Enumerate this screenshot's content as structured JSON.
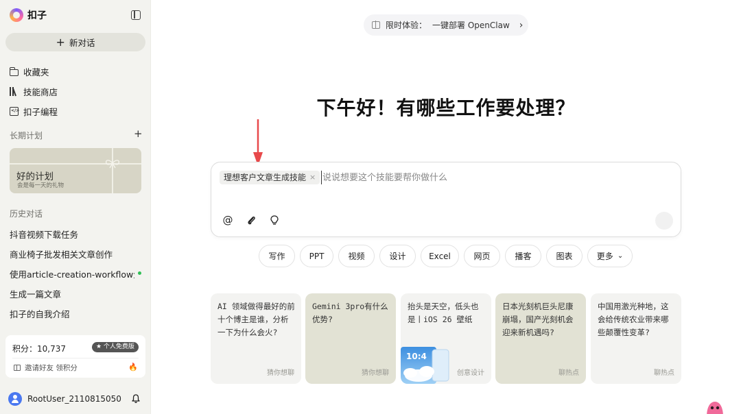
{
  "app": {
    "name": "扣子"
  },
  "sidebar": {
    "new_chat": "新对话",
    "nav": [
      {
        "label": "收藏夹",
        "icon": "folder-icon"
      },
      {
        "label": "技能商店",
        "icon": "books-icon"
      },
      {
        "label": "扣子编程",
        "icon": "code-icon"
      }
    ],
    "long_term_plan_label": "长期计划",
    "plan_card": {
      "title": "好的计划",
      "subtitle": "会是每一天的礼物"
    },
    "history_label": "历史对话",
    "history": [
      "抖音视频下载任务",
      "商业椅子批发相关文章创作",
      "使用article-creation-workflow生…",
      "生成一篇文章",
      "扣子的自我介绍"
    ],
    "points": {
      "label": "积分：10,737",
      "badge": "★ 个人免费版",
      "invite": "邀请好友 领积分"
    },
    "user": {
      "name": "RootUser_2110815050"
    }
  },
  "main": {
    "promo": {
      "prefix": "限时体验：",
      "text": "一键部署 OpenClaw"
    },
    "greeting": "下午好！有哪些工作要处理？",
    "input": {
      "skill_tag": "理想客户文章生成技能",
      "placeholder": "说说想要这个技能要帮你做什么"
    },
    "chips": [
      "写作",
      "PPT",
      "视频",
      "设计",
      "Excel",
      "网页",
      "播客",
      "图表",
      "更多"
    ],
    "cards": [
      {
        "text": "AI 领域做得最好的前十个博主是谁，分析一下为什么会火?",
        "tag": "猜你想聊"
      },
      {
        "text": "Gemini 3pro有什么优势?",
        "tag": "猜你想聊"
      },
      {
        "text": "抬头是天空，低头也是丨iOS 26 壁纸",
        "tag": "创意设计"
      },
      {
        "text": "日本光刻机巨头尼康崩塌，国产光刻机会迎来新机遇吗?",
        "tag": "聊热点"
      },
      {
        "text": "中国用激光种地，这会给传统农业带来哪些颠覆性变革?",
        "tag": "聊热点"
      }
    ]
  },
  "colors": {
    "sidebar_bg": "#f3f3ef",
    "plan_card_bg": "#d7d5c6",
    "card_highlight": "#e2e2d4",
    "accent_arrow": "#e8494b",
    "status_green": "#2fbf55"
  }
}
